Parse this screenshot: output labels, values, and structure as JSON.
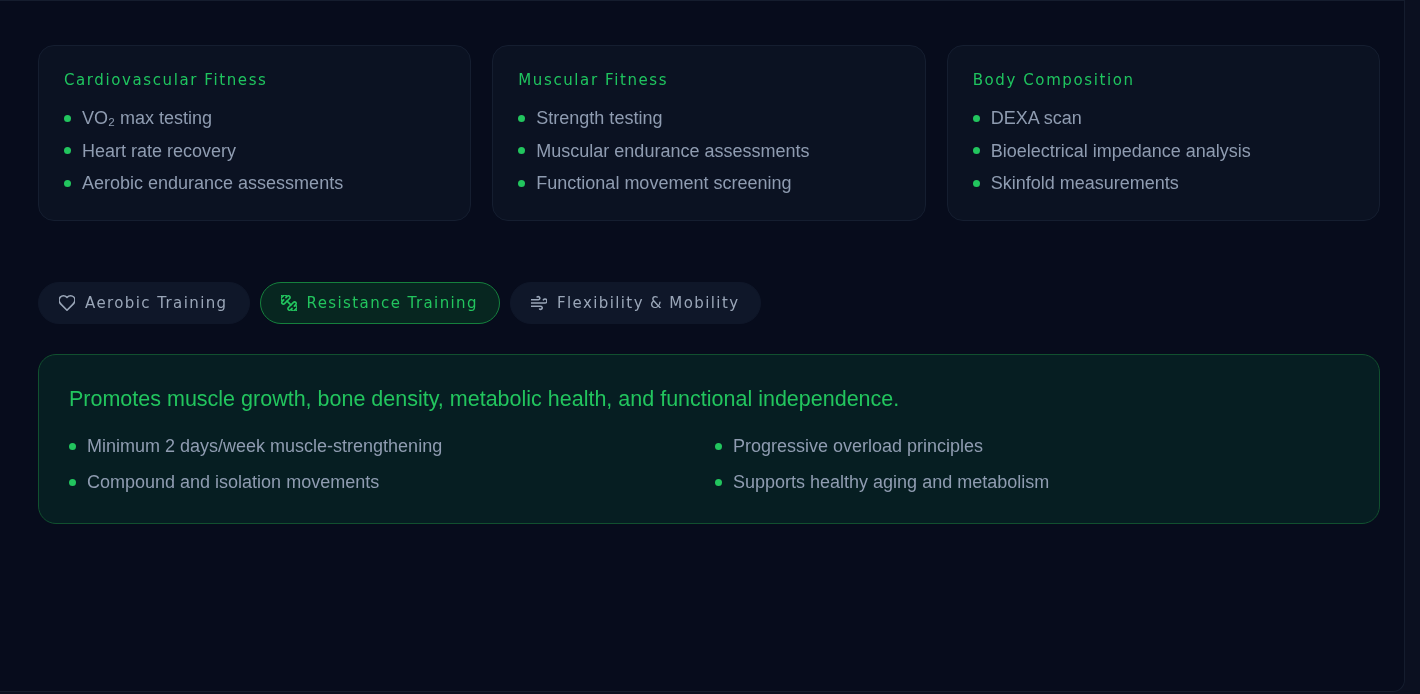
{
  "assessment_cards": [
    {
      "title": "Cardiovascular Fitness",
      "items": [
        "VO₂ max testing",
        "Heart rate recovery",
        "Aerobic endurance assessments"
      ]
    },
    {
      "title": "Muscular Fitness",
      "items": [
        "Strength testing",
        "Muscular endurance assessments",
        "Functional movement screening"
      ]
    },
    {
      "title": "Body Composition",
      "items": [
        "DEXA scan",
        "Bioelectrical impedance analysis",
        "Skinfold measurements"
      ]
    }
  ],
  "tabs": [
    {
      "label": "Aerobic Training",
      "selected": false
    },
    {
      "label": "Resistance Training",
      "selected": true
    },
    {
      "label": "Flexibility & Mobility",
      "selected": false
    }
  ],
  "detail_panel": {
    "heading": "Promotes muscle growth, bone density, metabolic health, and functional independence.",
    "items": [
      "Minimum 2 days/week muscle-strengthening",
      "Progressive overload principles",
      "Compound and isolation movements",
      "Supports healthy aging and metabolism"
    ]
  }
}
